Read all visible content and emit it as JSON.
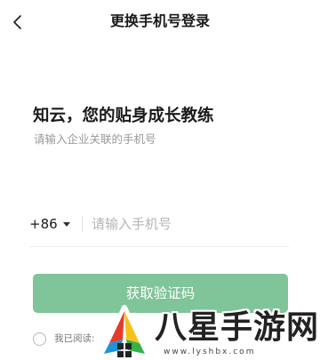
{
  "nav": {
    "back_icon": "chevron-left-icon",
    "title": "更换手机号登录"
  },
  "intro": {
    "headline": "知云，您的贴身成长教练",
    "subline": "请输入企业关联的手机号"
  },
  "phone_field": {
    "country_code": "+86",
    "caret_icon": "caret-down-icon",
    "placeholder": "请输入手机号",
    "value": ""
  },
  "submit_button": {
    "label": "获取验证码",
    "color": "#80c49a"
  },
  "agreement": {
    "checked": false,
    "text": "我已阅读:"
  },
  "watermark": {
    "text": "八星手游网",
    "url": "www.lyshbx.com"
  }
}
